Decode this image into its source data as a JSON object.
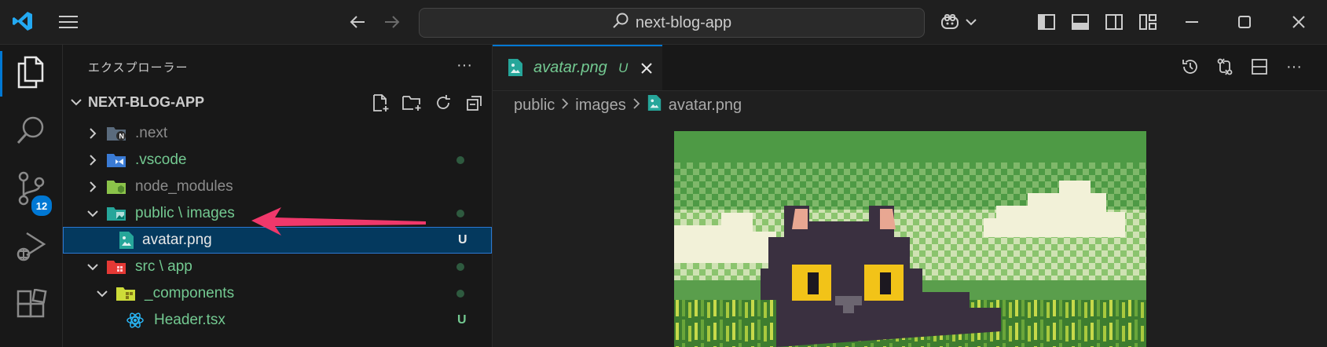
{
  "titlebar": {
    "search_text": "next-blog-app",
    "icons": [
      "vscode-logo-icon",
      "menu-icon",
      "back-arrow-icon",
      "forward-arrow-icon",
      "copilot-icon",
      "chevron-down-icon",
      "toggle-primary-sidebar-icon",
      "toggle-panel-icon",
      "toggle-secondary-sidebar-icon",
      "customize-layout-icon",
      "minimize-icon",
      "maximize-icon",
      "close-icon"
    ]
  },
  "activity_bar": {
    "items": [
      "explorer-icon",
      "search-icon",
      "source-control-icon",
      "run-debug-icon",
      "extensions-icon"
    ],
    "source_control_badge": "12"
  },
  "explorer": {
    "title": "エクスプローラー",
    "section_title": "NEXT-BLOG-APP",
    "rows": [
      {
        "label": ".next",
        "status": "",
        "dot": false
      },
      {
        "label": ".vscode",
        "status": "",
        "dot": true
      },
      {
        "label": "node_modules",
        "status": "",
        "dot": false
      },
      {
        "label": "public \\ images",
        "status": "",
        "dot": true
      },
      {
        "label": "avatar.png",
        "status": "U",
        "dot": false
      },
      {
        "label": "src \\ app",
        "status": "",
        "dot": true
      },
      {
        "label": "_components",
        "status": "",
        "dot": true
      },
      {
        "label": "Header.tsx",
        "status": "U",
        "dot": false
      }
    ]
  },
  "editor": {
    "tab_label": "avatar.png",
    "tab_status": "U",
    "breadcrumb": [
      "public",
      "images",
      "avatar.png"
    ]
  },
  "colors": {
    "accent": "#0078d4",
    "untracked_green": "#73c991",
    "annotation_arrow": "#f0386b"
  }
}
